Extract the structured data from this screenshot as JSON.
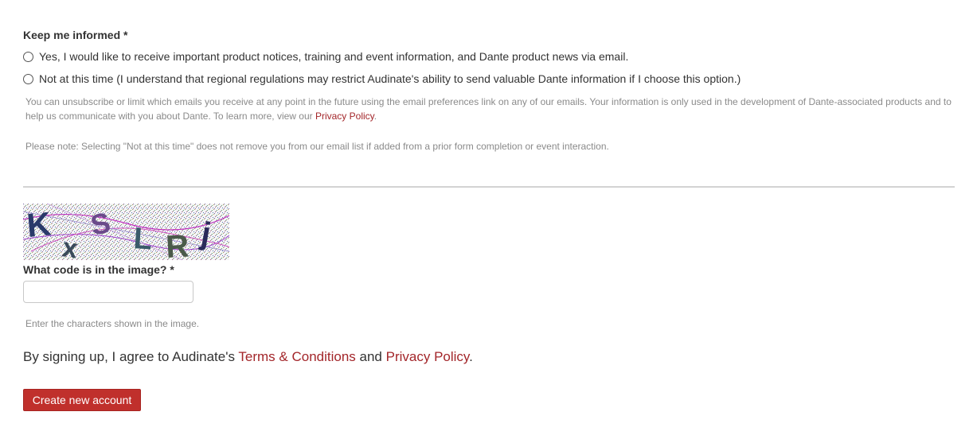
{
  "keep_informed": {
    "label": "Keep me informed *",
    "options": [
      {
        "label": "Yes, I would like to receive important product notices, training and event information, and Dante product news via email.",
        "selected": false
      },
      {
        "label": "Not at this time (I understand that regional regulations may restrict Audinate's ability to send valuable Dante information if I choose this option.)",
        "selected": false
      }
    ],
    "help_line1": "You can unsubscribe or limit which emails you receive at any point in the future using the email preferences link on any of our emails. Your information is only used in the development of Dante-associated products and to",
    "help_line2_text": "help us communicate with you about Dante. To learn more, view our ",
    "help_link": "Privacy Policy",
    "help_line2_end": ".",
    "note": "Please note: Selecting \"Not at this time\" does not remove you from our email list if added from a prior form completion or event interaction."
  },
  "captcha": {
    "image_text": "KxSLRj",
    "label": "What code is in the image? *",
    "input_value": "",
    "help": "Enter the characters shown in the image."
  },
  "consent": {
    "prefix": "By signing up, I agree to Audinate's ",
    "terms_link": "Terms & Conditions",
    "middle": " and ",
    "privacy_link": "Privacy Policy",
    "suffix": "."
  },
  "submit": {
    "label": "Create new account"
  },
  "colors": {
    "link": "#a3262a",
    "button": "#c0302c",
    "help_text": "#8a8a8a"
  }
}
